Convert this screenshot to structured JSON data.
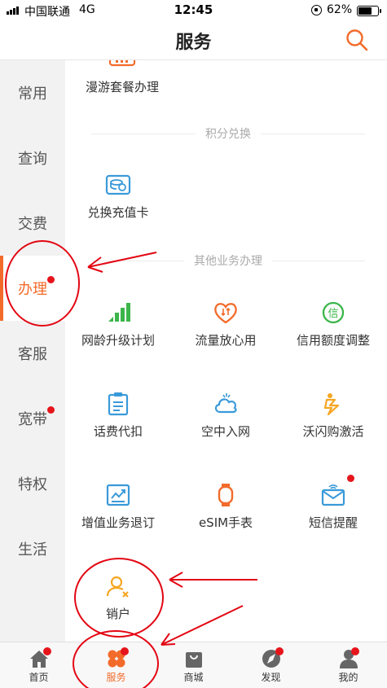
{
  "status_bar": {
    "carrier": "中国联通",
    "network": "4G",
    "time": "12:45",
    "battery_text": "62%",
    "battery_level": 0.62
  },
  "navbar": {
    "title": "服务",
    "search_icon": "search-icon"
  },
  "sidebar": {
    "items": [
      {
        "label": "常用",
        "active": false,
        "dot": false
      },
      {
        "label": "查询",
        "active": false,
        "dot": false
      },
      {
        "label": "交费",
        "active": false,
        "dot": false
      },
      {
        "label": "办理",
        "active": true,
        "dot": true
      },
      {
        "label": "客服",
        "active": false,
        "dot": false
      },
      {
        "label": "宽带",
        "active": false,
        "dot": true
      },
      {
        "label": "特权",
        "active": false,
        "dot": false
      },
      {
        "label": "生活",
        "active": false,
        "dot": false
      }
    ]
  },
  "content": {
    "top_item": {
      "label": "漫游套餐办理",
      "icon": "roaming-package-icon"
    },
    "sections": [
      {
        "header": "积分兑换",
        "items": [
          {
            "label": "兑换充值卡",
            "icon": "recharge-card-icon"
          }
        ]
      },
      {
        "header": "其他业务办理",
        "items": [
          {
            "label": "网龄升级计划",
            "icon": "signal-bars-icon"
          },
          {
            "label": "流量放心用",
            "icon": "heart-data-icon"
          },
          {
            "label": "信用额度调整",
            "icon": "credit-icon"
          },
          {
            "label": "话费代扣",
            "icon": "clipboard-icon"
          },
          {
            "label": "空中入网",
            "icon": "cloud-icon"
          },
          {
            "label": "沃闪购激活",
            "icon": "lightning-icon"
          },
          {
            "label": "增值业务退订",
            "icon": "chart-return-icon"
          },
          {
            "label": "eSIM手表",
            "icon": "watch-icon"
          },
          {
            "label": "短信提醒",
            "icon": "envelope-icon",
            "dot": true
          },
          {
            "label": "销户",
            "icon": "user-remove-icon"
          }
        ]
      }
    ]
  },
  "tabbar": {
    "tabs": [
      {
        "label": "首页",
        "icon": "home-icon",
        "active": false,
        "dot": true
      },
      {
        "label": "服务",
        "icon": "flower-icon",
        "active": true,
        "dot": true
      },
      {
        "label": "商城",
        "icon": "shopping-bag-icon",
        "active": false,
        "dot": false
      },
      {
        "label": "发现",
        "icon": "compass-icon",
        "active": false,
        "dot": true
      },
      {
        "label": "我的",
        "icon": "user-icon",
        "active": false,
        "dot": true
      }
    ]
  },
  "colors": {
    "accent": "#f26b2a",
    "badge": "#e5151b",
    "annotation": "#e30613"
  }
}
